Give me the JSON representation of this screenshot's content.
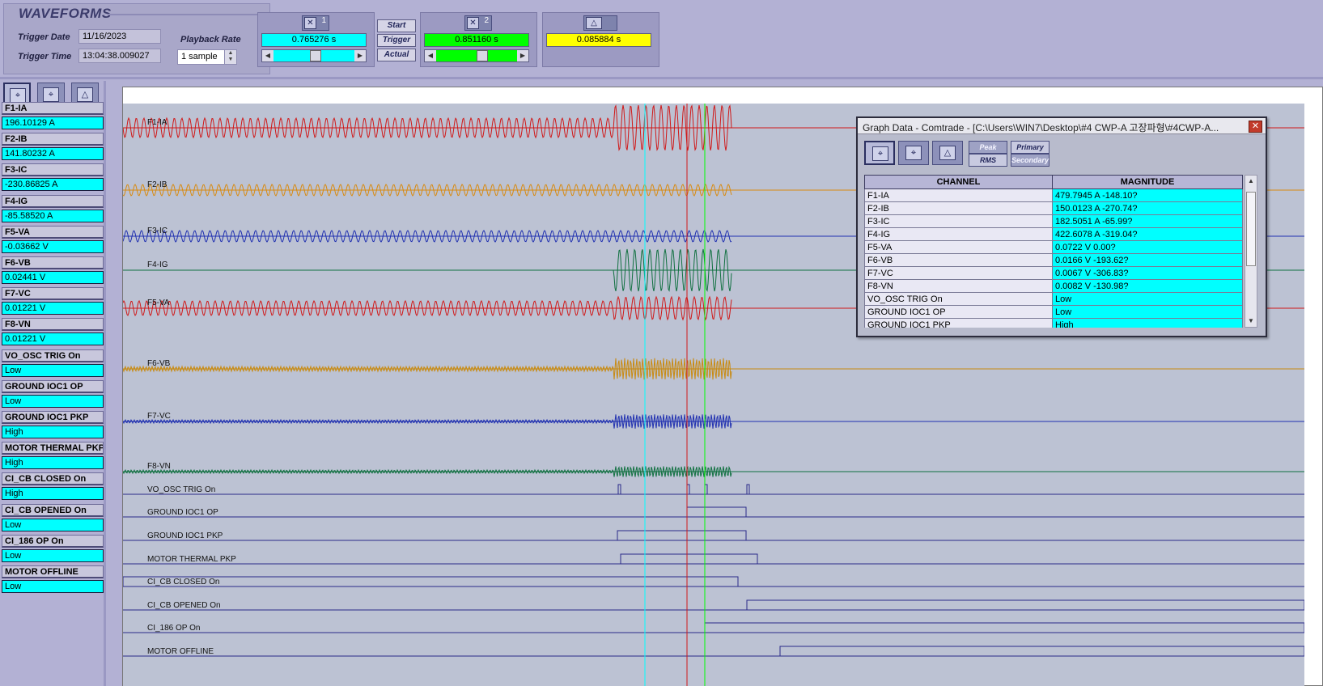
{
  "header": {
    "title": "WAVEFORMS",
    "trigger_date_label": "Trigger Date",
    "trigger_date": "11/16/2023",
    "trigger_time_label": "Trigger Time",
    "trigger_time": "13:04:38.009027",
    "playback_rate_label": "Playback Rate",
    "playback_rate": "1 sample"
  },
  "cursors": {
    "c1": {
      "index": "1",
      "value": "0.765276 s",
      "color": "#00ffff",
      "slider_pos": 0.45
    },
    "c2": {
      "index": "2",
      "value": "0.851160 s",
      "color": "#00ff00",
      "slider_pos": 0.5
    },
    "delta": {
      "value": "0.085884 s",
      "color": "#ffff00"
    }
  },
  "buttons": {
    "start": "Start",
    "trigger": "Trigger",
    "actual": "Actual"
  },
  "left_tabs": [
    {
      "index": "1"
    },
    {
      "index": "2"
    },
    {
      "index": ""
    }
  ],
  "channels": [
    {
      "name": "F1-IA",
      "value": "196.10129 A"
    },
    {
      "name": "F2-IB",
      "value": "141.80232 A"
    },
    {
      "name": "F3-IC",
      "value": "-230.86825 A"
    },
    {
      "name": "F4-IG",
      "value": "-85.58520 A"
    },
    {
      "name": "F5-VA",
      "value": "-0.03662 V"
    },
    {
      "name": "F6-VB",
      "value": "0.02441 V"
    },
    {
      "name": "F7-VC",
      "value": "0.01221 V"
    },
    {
      "name": "F8-VN",
      "value": "0.01221 V"
    },
    {
      "name": "VO_OSC TRIG  On",
      "value": "Low"
    },
    {
      "name": "GROUND IOC1 OP",
      "value": "Low"
    },
    {
      "name": "GROUND IOC1 PKP",
      "value": "High"
    },
    {
      "name": "MOTOR THERMAL PKP",
      "value": "High"
    },
    {
      "name": "CI_CB CLOSED On",
      "value": "High"
    },
    {
      "name": "CI_CB OPENED On",
      "value": "Low"
    },
    {
      "name": "CI_186 OP    On",
      "value": "Low"
    },
    {
      "name": "MOTOR OFFLINE",
      "value": "Low"
    }
  ],
  "traces": {
    "analog": [
      {
        "label": "F1-IA",
        "color": "#d01818"
      },
      {
        "label": "F2-IB",
        "color": "#d88a10"
      },
      {
        "label": "F3-IC",
        "color": "#2030b0"
      },
      {
        "label": "F4-IG",
        "color": "#107040"
      },
      {
        "label": "F5-VA",
        "color": "#d01818"
      },
      {
        "label": "F6-VB",
        "color": "#c88a10"
      },
      {
        "label": "F7-VC",
        "color": "#2030b0"
      },
      {
        "label": "F8-VN",
        "color": "#107040"
      }
    ],
    "digital": [
      {
        "label": "VO_OSC TRIG  On"
      },
      {
        "label": "GROUND IOC1 OP"
      },
      {
        "label": "GROUND IOC1 PKP"
      },
      {
        "label": "MOTOR THERMAL PKP"
      },
      {
        "label": "CI_CB CLOSED On"
      },
      {
        "label": "CI_CB OPENED On"
      },
      {
        "label": "CI_186 OP    On"
      },
      {
        "label": "MOTOR OFFLINE"
      }
    ]
  },
  "dialog": {
    "title": "Graph Data - Comtrade - [C:\\Users\\WIN7\\Desktop\\#4 CWP-A 고장파형\\#4CWP-A...",
    "close": "✕",
    "tool_indices": [
      "1",
      "2",
      ""
    ],
    "peak": "Peak",
    "rms": "RMS",
    "primary": "Primary",
    "secondary": "Secondary",
    "col_channel": "CHANNEL",
    "col_magnitude": "MAGNITUDE",
    "rows": [
      {
        "channel": "F1-IA",
        "magnitude": "479.7945 A  -148.10?"
      },
      {
        "channel": "F2-IB",
        "magnitude": "150.0123 A  -270.74?"
      },
      {
        "channel": "F3-IC",
        "magnitude": "182.5051 A  -65.99?"
      },
      {
        "channel": "F4-IG",
        "magnitude": "422.6078 A  -319.04?"
      },
      {
        "channel": "F5-VA",
        "magnitude": "0.0722 V  0.00?"
      },
      {
        "channel": "F6-VB",
        "magnitude": "0.0166 V  -193.62?"
      },
      {
        "channel": "F7-VC",
        "magnitude": "0.0067 V  -306.83?"
      },
      {
        "channel": "F8-VN",
        "magnitude": "0.0082 V  -130.98?"
      },
      {
        "channel": "VO_OSC TRIG  On",
        "magnitude": "Low"
      },
      {
        "channel": "GROUND IOC1 OP",
        "magnitude": "Low"
      },
      {
        "channel": "GROUND IOC1 PKP",
        "magnitude": "High"
      }
    ]
  }
}
